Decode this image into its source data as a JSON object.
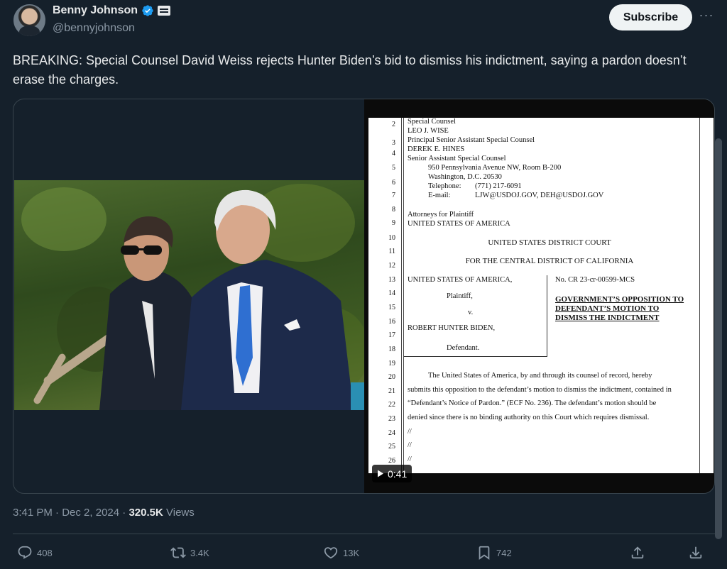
{
  "author": {
    "name": "Benny Johnson",
    "handle": "@bennyjohnson",
    "verified_icon": "verified-badge-icon",
    "affiliation_icon": "affiliation-badge-icon"
  },
  "header": {
    "subscribe_label": "Subscribe",
    "more_label": "···"
  },
  "tweet": {
    "text": "BREAKING: Special Counsel David Weiss rejects Hunter Biden’s bid to dismiss his indictment, saying a pardon doesn’t erase the charges."
  },
  "media": {
    "video_duration": "0:41",
    "document": {
      "header_lines": [
        "Special Counsel",
        "LEO J. WISE",
        "Principal Senior Assistant Special Counsel",
        "DEREK E. HINES",
        "Senior Assistant Special Counsel",
        "950 Pennsylvania Avenue NW, Room B-200",
        "Washington, D.C. 20530",
        "Telephone:",
        "(771) 217-6091",
        "E-mail:",
        "LJW@USDOJ.GOV, DEH@USDOJ.GOV",
        "Attorneys for Plaintiff",
        "UNITED STATES OF AMERICA"
      ],
      "court": "UNITED STATES DISTRICT COURT",
      "district": "FOR THE CENTRAL DISTRICT OF CALIFORNIA",
      "plaintiff_name": "UNITED STATES OF AMERICA,",
      "plaintiff_label": "Plaintiff,",
      "versus": "v.",
      "defendant_name": "ROBERT HUNTER BIDEN,",
      "defendant_label": "Defendant.",
      "case_no": "No. CR 23-cr-00599-MCS",
      "filing_title": [
        "GOVERNMENT’S OPPOSITION TO",
        "DEFENDANT’S MOTION TO",
        "DISMISS THE INDICTMENT"
      ],
      "body_lines": [
        "The United States of America, by and through its counsel of record, hereby",
        "submits this opposition to the defendant’s motion to dismiss the indictment, contained in",
        "“Defendant’s Notice of Pardon.” (ECF No. 236).  The defendant’s motion should be",
        "denied since there is no binding authority on this Court which requires dismissal."
      ],
      "slashes": [
        "//",
        "//",
        "//"
      ],
      "line_numbers": [
        "2",
        "3",
        "4",
        "5",
        "6",
        "7",
        "8",
        "9",
        "10",
        "11",
        "12",
        "13",
        "14",
        "15",
        "16",
        "17",
        "18",
        "19",
        "20",
        "21",
        "22",
        "23",
        "24",
        "25",
        "26"
      ]
    }
  },
  "meta": {
    "time": "3:41 PM",
    "separator": "·",
    "date": "Dec 2, 2024",
    "views_count": "320.5K",
    "views_label": "Views"
  },
  "actions": {
    "replies": "408",
    "reposts": "3.4K",
    "likes": "13K",
    "bookmarks": "742"
  }
}
